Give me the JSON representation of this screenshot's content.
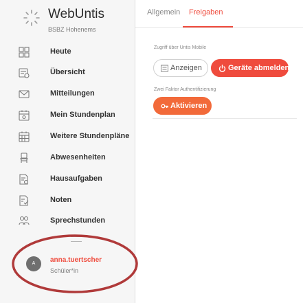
{
  "brand": {
    "title": "WebUntis",
    "subtitle": "BSBZ Hohenems"
  },
  "nav": {
    "items": [
      {
        "label": "Heute",
        "icon": "dashboard-icon"
      },
      {
        "label": "Übersicht",
        "icon": "overview-icon"
      },
      {
        "label": "Mitteilungen",
        "icon": "mail-icon"
      },
      {
        "label": "Mein Stundenplan",
        "icon": "calendar-icon"
      },
      {
        "label": "Weitere Stundenpläne",
        "icon": "calendar-grid-icon"
      },
      {
        "label": "Abwesenheiten",
        "icon": "chair-icon"
      },
      {
        "label": "Hausaufgaben",
        "icon": "homework-icon"
      },
      {
        "label": "Noten",
        "icon": "grades-icon"
      },
      {
        "label": "Sprechstunden",
        "icon": "people-icon"
      }
    ]
  },
  "user": {
    "initial": "A",
    "name": "anna.tuertscher",
    "role": "Schüler*in"
  },
  "tabs": [
    {
      "label": "Allgemein",
      "active": false
    },
    {
      "label": "Freigaben",
      "active": true
    }
  ],
  "sections": {
    "mobile": {
      "label": "Zugriff über Untis Mobile",
      "show_button": "Anzeigen",
      "logout_button": "Geräte abmelden"
    },
    "twofactor": {
      "label": "Zwei Faktor Authentifizierung",
      "activate_button": "Aktivieren"
    }
  },
  "colors": {
    "accent": "#ef4b3d",
    "orange": "#f26a3a",
    "highlight_circle": "#b03a3a"
  }
}
